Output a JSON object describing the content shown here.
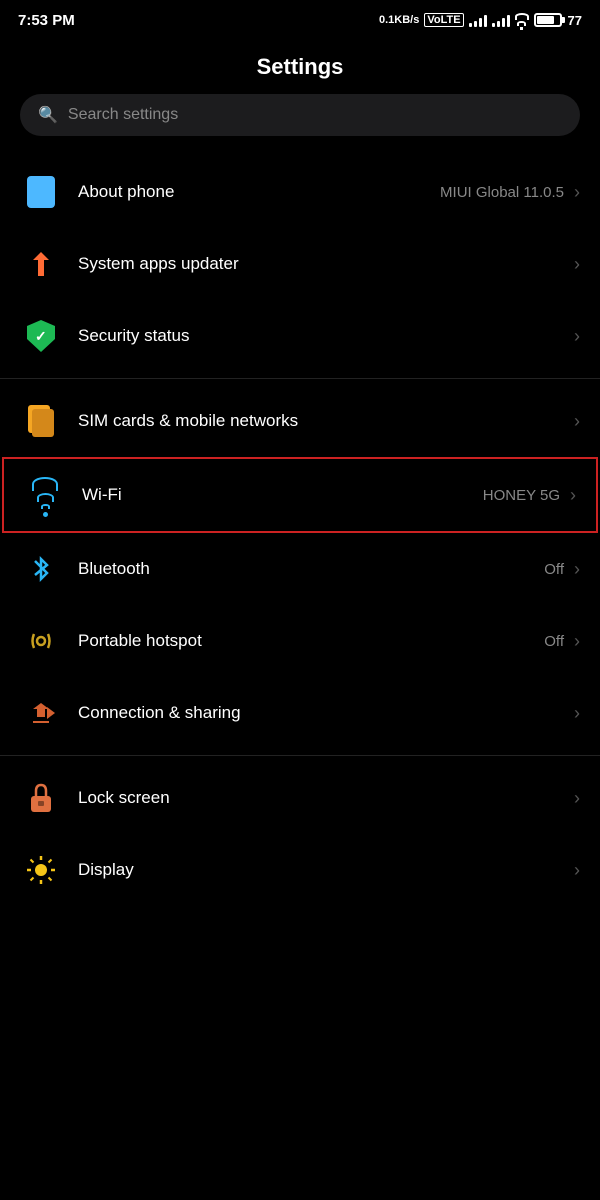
{
  "statusBar": {
    "time": "7:53 PM",
    "network": "0.1KB/s",
    "networkType": "VoLTE",
    "battery": "77"
  },
  "header": {
    "title": "Settings"
  },
  "search": {
    "placeholder": "Search settings"
  },
  "items": {
    "aboutPhone": {
      "label": "About phone",
      "value": "MIUI Global 11.0.5"
    },
    "systemApps": {
      "label": "System apps updater",
      "value": ""
    },
    "securityStatus": {
      "label": "Security status",
      "value": ""
    },
    "simCards": {
      "label": "SIM cards & mobile networks",
      "value": ""
    },
    "wifi": {
      "label": "Wi-Fi",
      "value": "HONEY 5G"
    },
    "bluetooth": {
      "label": "Bluetooth",
      "value": "Off"
    },
    "portableHotspot": {
      "label": "Portable hotspot",
      "value": "Off"
    },
    "connectionSharing": {
      "label": "Connection & sharing",
      "value": ""
    },
    "lockScreen": {
      "label": "Lock screen",
      "value": ""
    },
    "display": {
      "label": "Display",
      "value": ""
    }
  }
}
